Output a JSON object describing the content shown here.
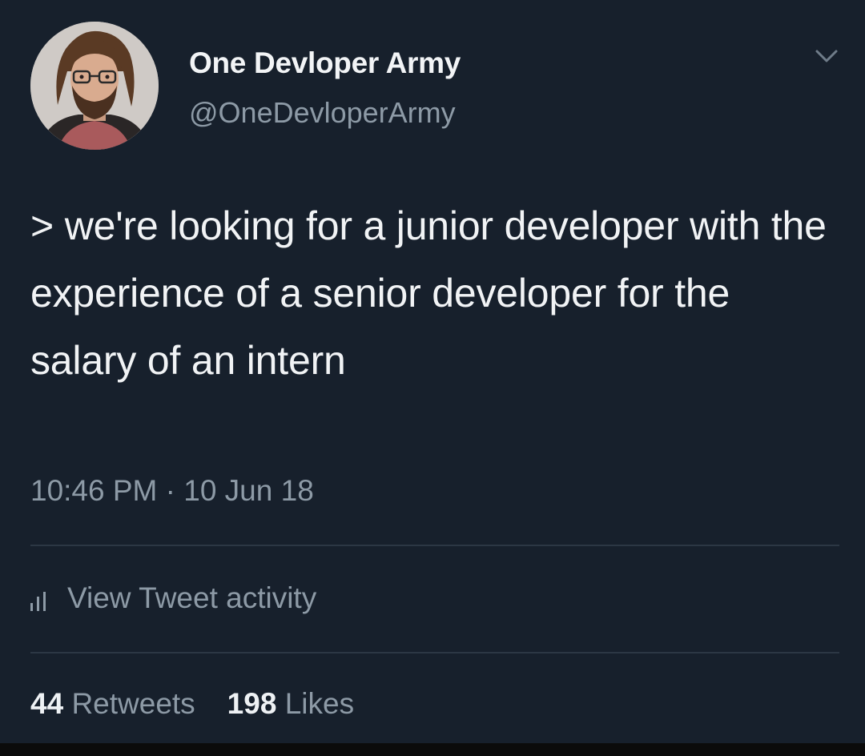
{
  "user": {
    "display_name": "One Devloper Army",
    "handle": "@OneDevloperArmy",
    "avatar_icon": "profile-photo"
  },
  "tweet": {
    "text": "> we're looking for a junior developer with the experience of a senior developer for the salary of an intern",
    "timestamp": "10:46 PM · 10 Jun 18"
  },
  "activity": {
    "label": "View Tweet activity",
    "icon": "bar-chart-icon"
  },
  "stats": {
    "retweets_count": "44",
    "retweets_label": "Retweets",
    "likes_count": "198",
    "likes_label": "Likes"
  },
  "colors": {
    "background": "#17202c",
    "primary_text": "#f1f3f5",
    "secondary_text": "#8d9aa6",
    "divider": "#2c3744"
  }
}
